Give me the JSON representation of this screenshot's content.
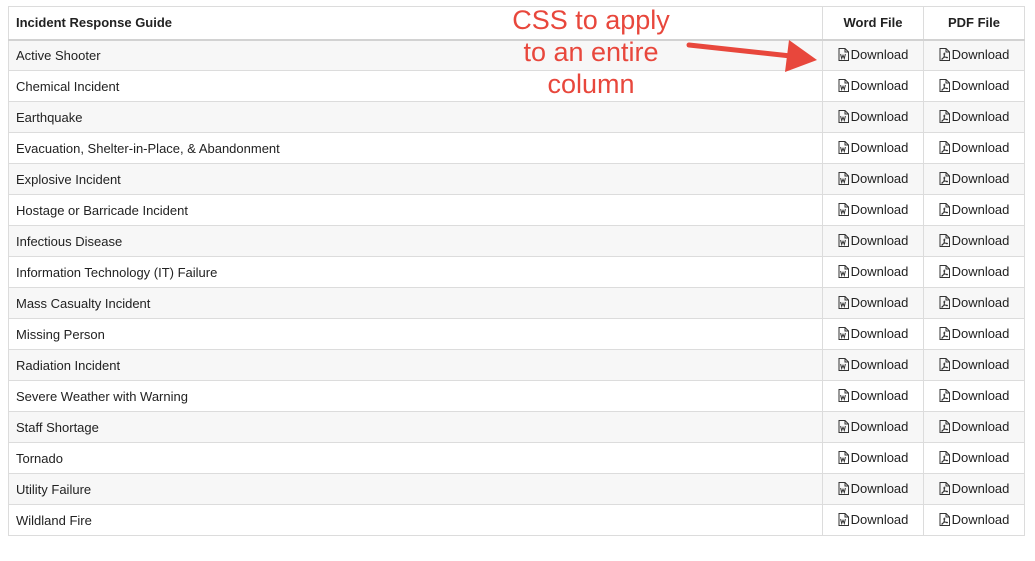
{
  "table": {
    "headers": {
      "name": "Incident Response Guide",
      "word": "Word File",
      "pdf": "PDF File"
    },
    "download_label": "Download",
    "rows": [
      {
        "name": "Active Shooter"
      },
      {
        "name": "Chemical Incident"
      },
      {
        "name": "Earthquake"
      },
      {
        "name": "Evacuation, Shelter-in-Place, & Abandonment"
      },
      {
        "name": "Explosive Incident"
      },
      {
        "name": "Hostage or Barricade Incident"
      },
      {
        "name": "Infectious Disease"
      },
      {
        "name": "Information Technology (IT) Failure"
      },
      {
        "name": "Mass Casualty Incident"
      },
      {
        "name": "Missing Person"
      },
      {
        "name": "Radiation Incident"
      },
      {
        "name": "Severe Weather with Warning"
      },
      {
        "name": "Staff Shortage"
      },
      {
        "name": "Tornado"
      },
      {
        "name": "Utility Failure"
      },
      {
        "name": "Wildland Fire"
      }
    ]
  },
  "annotation": {
    "lines": [
      "CSS to apply",
      "to an entire",
      "column"
    ],
    "color": "#e8473c"
  },
  "icons": {
    "word": "word-file-icon",
    "pdf": "pdf-file-icon",
    "arrow": "arrow-icon"
  }
}
